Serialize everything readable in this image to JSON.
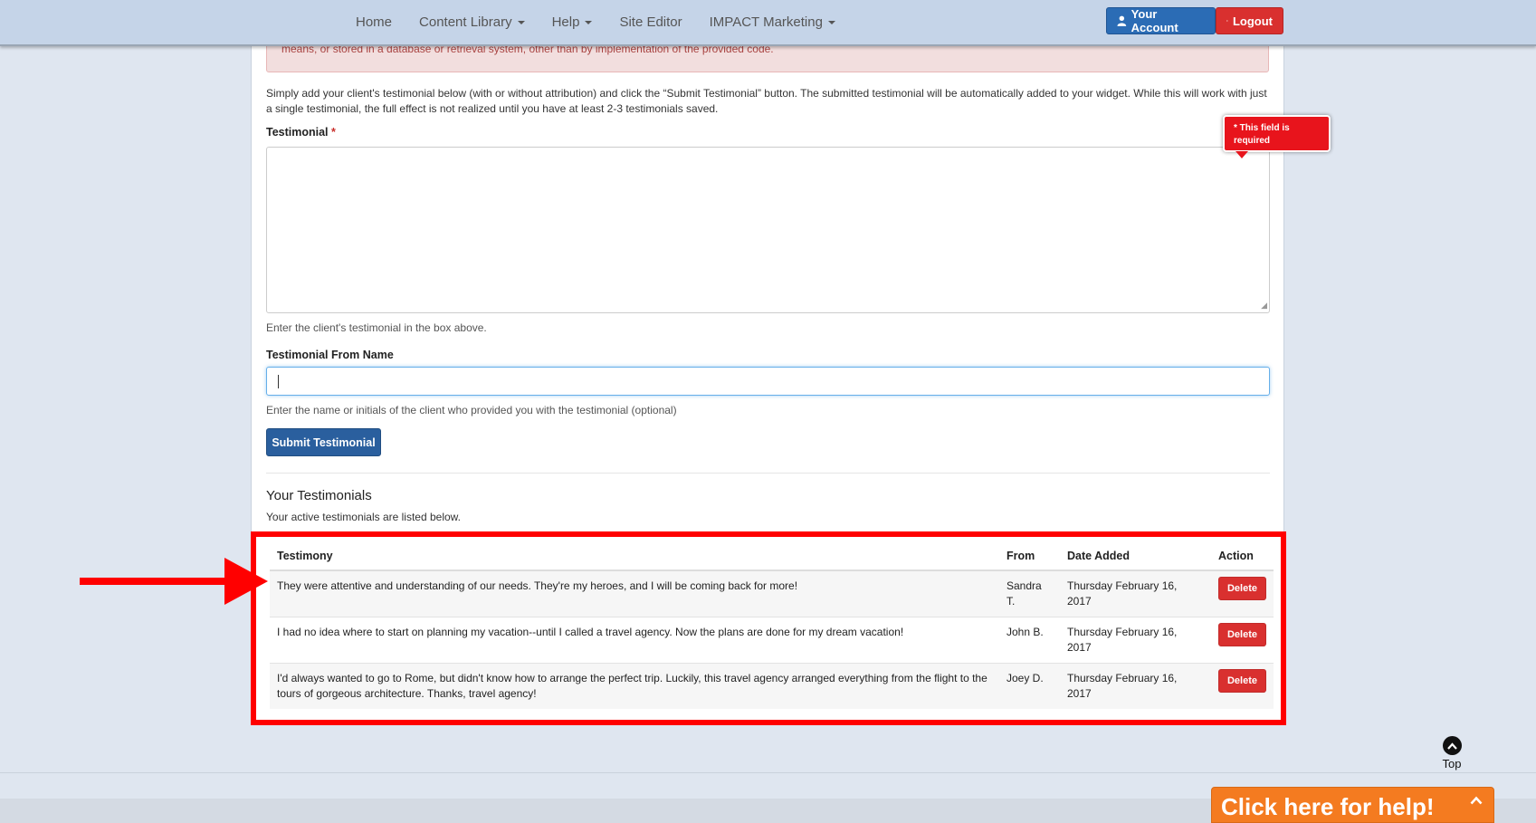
{
  "nav": {
    "links": [
      {
        "label": "Home",
        "dropdown": false
      },
      {
        "label": "Content Library",
        "dropdown": true
      },
      {
        "label": "Help",
        "dropdown": true
      },
      {
        "label": "Site Editor",
        "dropdown": false
      },
      {
        "label": "IMPACT Marketing",
        "dropdown": true
      }
    ],
    "account_label": "Your Account",
    "logout_label": "Logout"
  },
  "alert": {
    "text": "means, or stored in a database or retrieval system, other than by implementation of the provided code."
  },
  "form": {
    "intro": "Simply add your client's testimonial below (with or without attribution) and click the “Submit Testimonial” button. The submitted testimonial will be automatically added to your widget. While this will work with just a single testimonial, the full effect is not realized until you have at least 2-3 testimonials saved.",
    "testimonial_label": "Testimonial",
    "required_marker": "*",
    "testimonial_help": "Enter the client's testimonial in the box above.",
    "from_label": "Testimonial From Name",
    "from_help": "Enter the name or initials of the client who provided you with the testimonial (optional)",
    "submit_label": "Submit Testimonial",
    "tooltip": "* This field is required"
  },
  "testimonials": {
    "title": "Your Testimonials",
    "subtitle": "Your active testimonials are listed below.",
    "headers": {
      "testimony": "Testimony",
      "from": "From",
      "date": "Date Added",
      "action": "Action"
    },
    "rows": [
      {
        "testimony": "They were attentive and understanding of our needs. They're my heroes, and I will be coming back for more!",
        "from": "Sandra T.",
        "date": "Thursday February 16, 2017",
        "action": "Delete"
      },
      {
        "testimony": "I had no idea where to start on planning my vacation--until I called a travel agency. Now the plans are done for my dream vacation!",
        "from": "John B.",
        "date": "Thursday February 16, 2017",
        "action": "Delete"
      },
      {
        "testimony": "I'd always wanted to go to Rome, but didn't know how to arrange the perfect trip. Luckily, this travel agency arranged everything from the flight to the tours of gorgeous architecture. Thanks, travel agency!",
        "from": "Joey D.",
        "date": "Thursday February 16, 2017",
        "action": "Delete"
      }
    ]
  },
  "footer": {
    "top_label": "Top",
    "help_widget": "Click here for help!"
  },
  "colors": {
    "highlight": "#ff0000",
    "primary": "#2a5f9e",
    "danger": "#d9302f",
    "help_widget": "#f47b20"
  },
  "icons": [
    "user-icon",
    "logout-icon",
    "chevron-up-icon",
    "arrow-right-icon",
    "caret-down-icon"
  ]
}
